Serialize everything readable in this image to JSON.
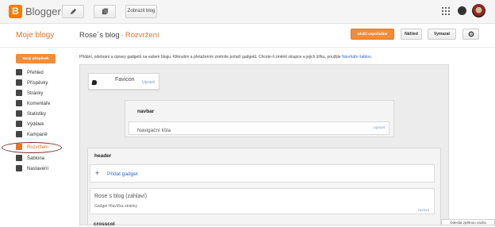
{
  "app": {
    "name": "Blogger",
    "view_blog_label": "Zobrazit blog"
  },
  "header": {
    "my_blogs": "Moje blogy",
    "blog_name": "Rose´s blog",
    "separator": "·",
    "current_page": "Rozvržení"
  },
  "actions": {
    "save": "Uložit uspořádání",
    "preview": "Náhled",
    "clear": "Vymazat"
  },
  "sidebar": {
    "new_post": "Nový příspěvek",
    "items": [
      {
        "label": "Přehled",
        "icon": "home-icon"
      },
      {
        "label": "Příspěvky",
        "icon": "posts-icon"
      },
      {
        "label": "Stránky",
        "icon": "pages-icon"
      },
      {
        "label": "Komentáře",
        "icon": "comments-icon"
      },
      {
        "label": "Statistiky",
        "icon": "stats-icon"
      },
      {
        "label": "Výdělek",
        "icon": "trophy-icon"
      },
      {
        "label": "Kampaně",
        "icon": "campaign-icon"
      },
      {
        "label": "Rozvržení",
        "icon": "layout-icon"
      },
      {
        "label": "Šablona",
        "icon": "template-icon"
      },
      {
        "label": "Nastavení",
        "icon": "wrench-icon"
      }
    ]
  },
  "main": {
    "description": "Přidání, odebrání a úpravy gadgetů na vašem blogu. Kliknutím a přetažením změníte pořadí gadgetů. Chcete-li změnit sloupce a jejich šířku, použijte",
    "description_link": "Návrháře šablon.",
    "favicon": {
      "label": "Favicon",
      "edit": "Upravit"
    },
    "navbar_section": {
      "title": "navbar",
      "gadget_name": "Navigační lišta",
      "edit": "Upravit"
    },
    "header_section": {
      "title": "header",
      "add_gadget": "Přidat gadget",
      "gadget_name": "Rose´s blog (záhlaví)",
      "gadget_type": "Gadget Hlavička stránky",
      "edit": "Upravit"
    },
    "next_section_title": "crosscol",
    "tooltip": "Odeslat zpětnou vazbu"
  },
  "colors": {
    "accent": "#f08c3a",
    "link": "#3366cc"
  }
}
